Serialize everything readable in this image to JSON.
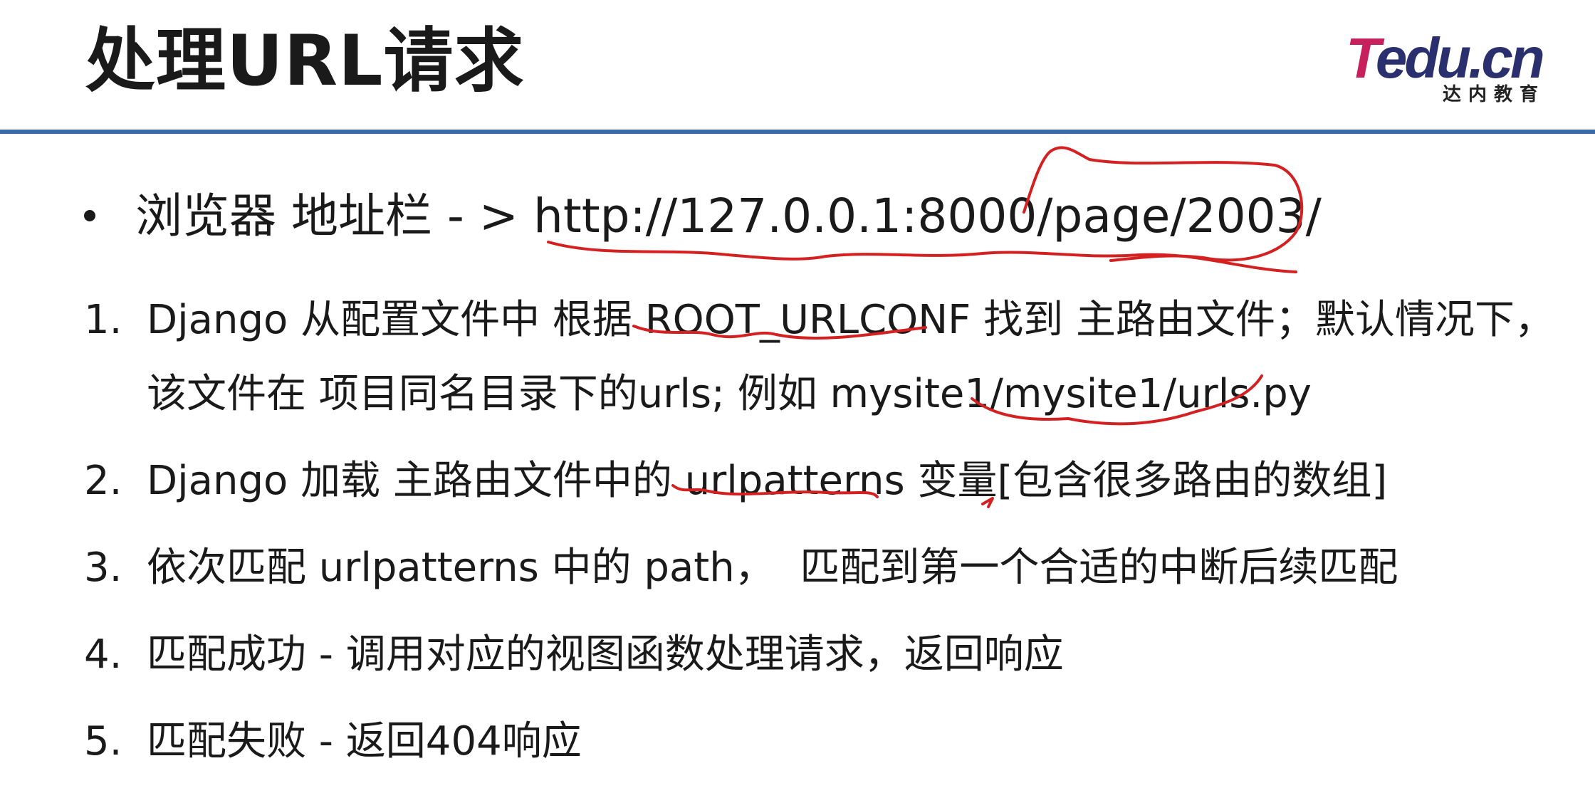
{
  "slide": {
    "title": "处理URL请求",
    "logo": {
      "brand_t": "T",
      "brand_rest": "edu.cn",
      "sub": "达内教育"
    },
    "bullet": "浏览器  地址栏 - > http://127.0.0.1:8000/page/2003/",
    "steps": [
      {
        "num": "1.",
        "text": "Django 从配置文件中 根据 ROOT_URLCONF 找到 主路由文件；默认情况下，该文件在 项目同名目录下的urls; 例如 mysite1/mysite1/urls.py"
      },
      {
        "num": "2.",
        "text": "Django 加载 主路由文件中的 urlpatterns 变量[包含很多路由的数组]"
      },
      {
        "num": "3.",
        "text": "依次匹配 urlpatterns 中的 path，  匹配到第一个合适的中断后续匹配"
      },
      {
        "num": "4.",
        "text": "匹配成功 - 调用对应的视图函数处理请求，返回响应"
      },
      {
        "num": "5.",
        "text": "匹配失败 - 返回404响应"
      }
    ],
    "colors": {
      "divider": "#3a6aa8",
      "annotation": "#d42020",
      "logo_t": "#c8205c",
      "logo_rest": "#2a2f6e"
    }
  }
}
